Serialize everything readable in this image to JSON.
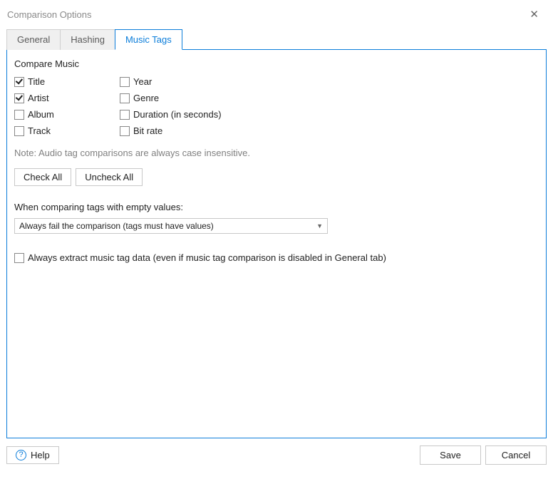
{
  "window": {
    "title": "Comparison Options"
  },
  "tabs": {
    "general": "General",
    "hashing": "Hashing",
    "music_tags": "Music Tags"
  },
  "section": {
    "compare_music": "Compare Music",
    "title": "Title",
    "artist": "Artist",
    "album": "Album",
    "track": "Track",
    "year": "Year",
    "genre": "Genre",
    "duration": "Duration (in seconds)",
    "bitrate": "Bit rate",
    "note": "Note: Audio tag comparisons are always case insensitive.",
    "check_all": "Check All",
    "uncheck_all": "Uncheck All",
    "when_comparing": "When comparing tags with empty values:",
    "combo_value": "Always fail the comparison (tags must have values)",
    "always_extract": "Always extract music tag data (even if music tag comparison is disabled in General tab)"
  },
  "footer": {
    "help": "Help",
    "save": "Save",
    "cancel": "Cancel"
  },
  "state": {
    "title_checked": true,
    "artist_checked": true,
    "album_checked": false,
    "track_checked": false,
    "year_checked": false,
    "genre_checked": false,
    "duration_checked": false,
    "bitrate_checked": false,
    "always_extract_checked": false
  }
}
